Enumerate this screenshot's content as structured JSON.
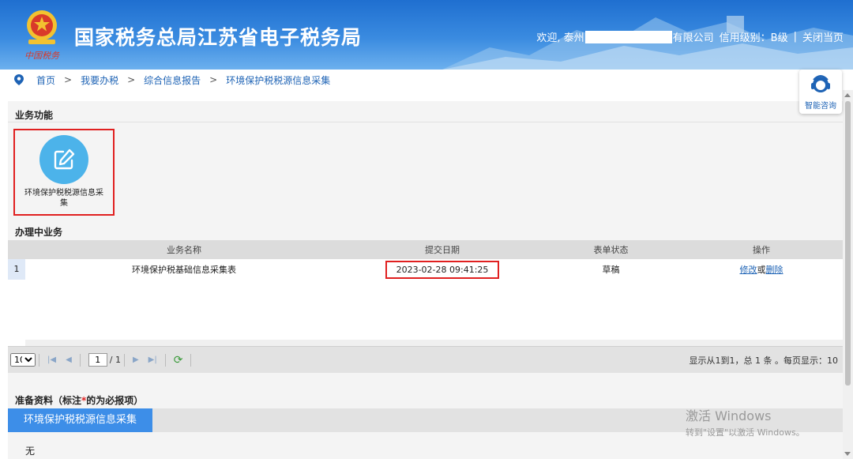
{
  "header": {
    "site_title": "国家税务总局江苏省电子税务局",
    "welcome_prefix": "欢迎, 泰州",
    "welcome_suffix": "有限公司",
    "credit_level": "信用级别：B级",
    "close_link": "关闭当页",
    "emblem_caption": "中国税务"
  },
  "breadcrumb": {
    "items": [
      "首页",
      "我要办税",
      "综合信息报告"
    ],
    "current": "环境保护税税源信息采集",
    "separator": ">"
  },
  "consult": {
    "label": "智能咨询"
  },
  "business_functions": {
    "title": "业务功能",
    "cards": [
      {
        "label": "环境保护税税源信息采集",
        "icon": "edit-icon"
      }
    ]
  },
  "in_progress": {
    "title": "办理中业务",
    "columns": [
      "业务名称",
      "提交日期",
      "表单状态",
      "操作"
    ],
    "rows": [
      {
        "index": "1",
        "name": "环境保护税基础信息采集表",
        "date": "2023-02-28 09:41:25",
        "status": "草稿",
        "op_edit": "修改",
        "op_or": "或",
        "op_delete": "删除"
      }
    ]
  },
  "pager": {
    "page_size": "10",
    "page_size_options": [
      "10"
    ],
    "current_page": "1",
    "total_pages": "/ 1",
    "summary": "显示从1到1，总 1 条 。每页显示：10"
  },
  "preparation": {
    "title_prefix": "准备资料（标注",
    "required_mark": "*",
    "title_suffix": "的为必报项）",
    "tab_label": "环境保护税税源信息采集",
    "empty_text": "无"
  },
  "watermark": {
    "line1": "激活 Windows",
    "line2": "转到\"设置\"以激活 Windows。"
  },
  "colors": {
    "header_blue": "#1f6fd0",
    "link_blue": "#1e63b5",
    "icon_circle": "#4cb3ea",
    "highlight_red": "#e02020",
    "tab_blue": "#3d8ee8"
  }
}
